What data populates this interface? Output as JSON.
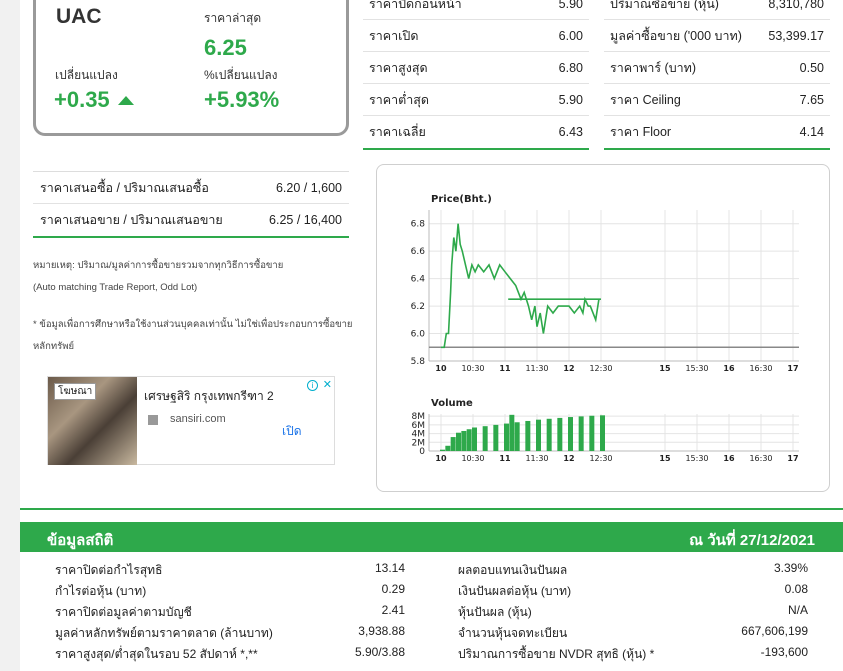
{
  "stock": {
    "symbol": "UAC",
    "last_label": "ราคาล่าสุด",
    "last_value": "6.25",
    "change_label": "เปลี่ยนแปลง",
    "change_value": "+0.35",
    "pct_label": "%เปลี่ยนแปลง",
    "pct_value": "+5.93%",
    "color_up": "#2ea94b"
  },
  "price_table_left": [
    {
      "label": "ราคาปิดก่อนหน้า",
      "value": "5.90"
    },
    {
      "label": "ราคาเปิด",
      "value": "6.00"
    },
    {
      "label": "ราคาสูงสุด",
      "value": "6.80"
    },
    {
      "label": "ราคาต่ำสุด",
      "value": "5.90"
    },
    {
      "label": "ราคาเฉลี่ย",
      "value": "6.43"
    }
  ],
  "price_table_right": [
    {
      "label": "ปริมาณซื้อขาย (หุ้น)",
      "value": "8,310,780"
    },
    {
      "label": "มูลค่าซื้อขาย ('000 บาท)",
      "value": "53,399.17"
    },
    {
      "label": "ราคาพาร์ (บาท)",
      "value": "0.50"
    },
    {
      "label": "ราคา Ceiling",
      "value": "7.65"
    },
    {
      "label": "ราคา Floor",
      "value": "4.14"
    }
  ],
  "bid_offer": [
    {
      "label": "ราคาเสนอซื้อ / ปริมาณเสนอซื้อ",
      "value": "6.20 / 1,600"
    },
    {
      "label": "ราคาเสนอขาย / ปริมาณเสนอขาย",
      "value": "6.25 / 16,400"
    }
  ],
  "notes": {
    "line1": "หมายเหตุ: ปริมาณ/มูลค่าการซื้อขายรวมจากทุกวิธีการซื้อขาย",
    "line2": "(Auto matching Trade Report, Odd Lot)",
    "line3": "* ข้อมูลเพื่อการศึกษาหรือใช้งานส่วนบุคคลเท่านั้น ไม่ใช่เพื่อประกอบการซื้อขาย",
    "line4": "หลักทรัพย์"
  },
  "ad": {
    "tag": "โฆษณา",
    "title": "เศรษฐสิริ กรุงเทพกรีฑา 2",
    "site": "sansiri.com",
    "open": "เปิด",
    "info_icon": "i",
    "close_icon": "✕"
  },
  "chart_data": [
    {
      "type": "line",
      "title": "Price(Bht.)",
      "x_ticks": [
        "10",
        "10:30",
        "11",
        "11:30",
        "12",
        "12:30",
        "15",
        "15:30",
        "16",
        "16:30",
        "17"
      ],
      "y_ticks": [
        "6.8",
        "6.6",
        "6.4",
        "6.2",
        "6.0",
        "5.8"
      ],
      "ylim": [
        5.8,
        6.9
      ],
      "reference_line": 5.9,
      "series": [
        {
          "x": [
            "10:00",
            "10:03",
            "10:05",
            "10:07",
            "10:09",
            "10:10",
            "10:12",
            "10:14",
            "10:16",
            "10:18",
            "10:20",
            "10:23",
            "10:26",
            "10:29",
            "10:32",
            "10:35",
            "10:40",
            "10:45",
            "10:50",
            "10:55",
            "11:00",
            "11:05",
            "11:10",
            "11:15",
            "11:18",
            "11:22",
            "11:25",
            "11:28",
            "11:30",
            "11:33",
            "11:36",
            "11:40",
            "11:45",
            "11:50",
            "11:55",
            "12:00",
            "12:05",
            "12:10",
            "12:13",
            "12:15",
            "12:18",
            "12:20",
            "12:25",
            "12:28",
            "12:30",
            "12:33",
            "12:40"
          ],
          "y": [
            5.9,
            5.9,
            6.0,
            6.0,
            6.3,
            6.5,
            6.7,
            6.6,
            6.8,
            6.65,
            6.6,
            6.5,
            6.4,
            6.5,
            6.45,
            6.5,
            6.45,
            6.5,
            6.4,
            6.5,
            6.45,
            6.4,
            6.35,
            6.25,
            6.3,
            6.2,
            6.1,
            6.2,
            6.05,
            6.15,
            6.0,
            6.2,
            6.15,
            6.2,
            6.2,
            6.2,
            6.15,
            6.2,
            6.15,
            6.25,
            6.2,
            6.2,
            6.1,
            6.25,
            6.25,
            6.25,
            6.25
          ]
        }
      ]
    },
    {
      "type": "area",
      "title": "Volume",
      "x_ticks": [
        "10",
        "10:30",
        "11",
        "11:30",
        "12",
        "12:30",
        "15",
        "15:30",
        "16",
        "16:30",
        "17"
      ],
      "y_ticks": [
        "8M",
        "6M",
        "4M",
        "2M",
        "0"
      ],
      "ylim": [
        0,
        8.5
      ],
      "series": [
        {
          "x": [
            "10:00",
            "10:05",
            "10:10",
            "10:15",
            "10:20",
            "10:25",
            "10:30",
            "10:40",
            "10:50",
            "11:00",
            "11:10",
            "11:20",
            "11:30",
            "11:40",
            "11:50",
            "12:00",
            "12:10",
            "12:20",
            "12:30",
            "12:35"
          ],
          "y": [
            0.3,
            1.2,
            3.2,
            4.2,
            4.6,
            5.0,
            5.4,
            5.7,
            6.0,
            6.3,
            6.6,
            6.9,
            7.2,
            7.4,
            7.6,
            7.8,
            7.95,
            8.1,
            8.2,
            8.31
          ]
        }
      ]
    }
  ],
  "stats": {
    "title": "ข้อมูลสถิติ",
    "date": "ณ วันที่ 27/12/2021",
    "left": [
      {
        "label": "ราคาปิดต่อกำไรสุทธิ",
        "value": "13.14"
      },
      {
        "label": "กำไรต่อหุ้น (บาท)",
        "value": "0.29"
      },
      {
        "label": "ราคาปิดต่อมูลค่าตามบัญชี",
        "value": "2.41"
      },
      {
        "label": "มูลค่าหลักทรัพย์ตามราคาตลาด (ล้านบาท)",
        "value": "3,938.88"
      },
      {
        "label": "ราคาสูงสุด/ต่ำสุดในรอบ 52 สัปดาห์ *,**",
        "value": "5.90/3.88"
      }
    ],
    "right": [
      {
        "label": "ผลตอบแทนเงินปันผล",
        "value": "3.39%"
      },
      {
        "label": "เงินปันผลต่อหุ้น (บาท)",
        "value": "0.08"
      },
      {
        "label": "หุ้นปันผล (หุ้น)",
        "value": "N/A"
      },
      {
        "label": "จำนวนหุ้นจดทะเบียน",
        "value": "667,606,199"
      },
      {
        "label": "ปริมาณการซื้อขาย NVDR สุทธิ (หุ้น) *",
        "value": "-193,600"
      }
    ]
  }
}
